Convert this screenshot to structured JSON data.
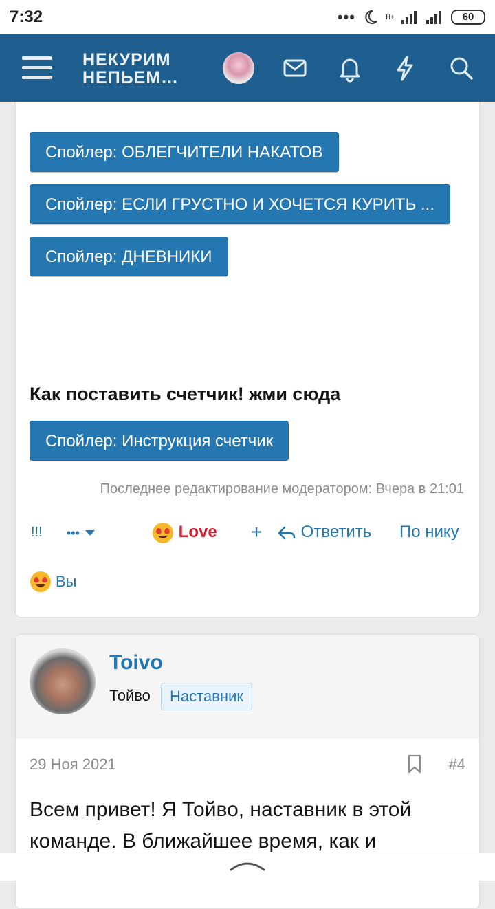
{
  "status": {
    "time": "7:32",
    "dots": "•••",
    "network": "H+",
    "battery": "60"
  },
  "header": {
    "logo_line1": "НЕКУРИМ",
    "logo_line2": "НЕПЬЕМ…"
  },
  "post1": {
    "spoilers": [
      "Спойлер: ОБЛЕГЧИТЕЛИ НАКАТОВ",
      "Спойлер: ЕСЛИ ГРУСТНО И ХОЧЕТСЯ КУРИТЬ ...",
      "Спойлер: ДНЕВНИКИ"
    ],
    "heading": "Как поставить счетчик! жми сюда",
    "counter_spoiler": "Спойлер: Инструкция счетчик",
    "edited": "Последнее редактирование модератором: Вчера в 21:01",
    "actions": {
      "report": "!!!",
      "more": "•••",
      "love": "Love",
      "plus": "+",
      "reply": "Ответить",
      "by_nick": "По нику"
    },
    "reactions_label": "Вы"
  },
  "post2": {
    "username": "Toivo",
    "realname": "Тойво",
    "badge": "Наставник",
    "date": "29 Ноя 2021",
    "number": "#4",
    "body": "Всем привет! Я Тойво, наставник в этой команде. В ближайшее время, как и"
  },
  "icons": {
    "header": [
      "menu-icon",
      "avatar",
      "envelope-icon",
      "bell-icon",
      "bolt-icon",
      "search-icon"
    ]
  },
  "colors": {
    "brand": "#1e5f8f",
    "accent": "#2577b1",
    "love": "#d1242f"
  }
}
